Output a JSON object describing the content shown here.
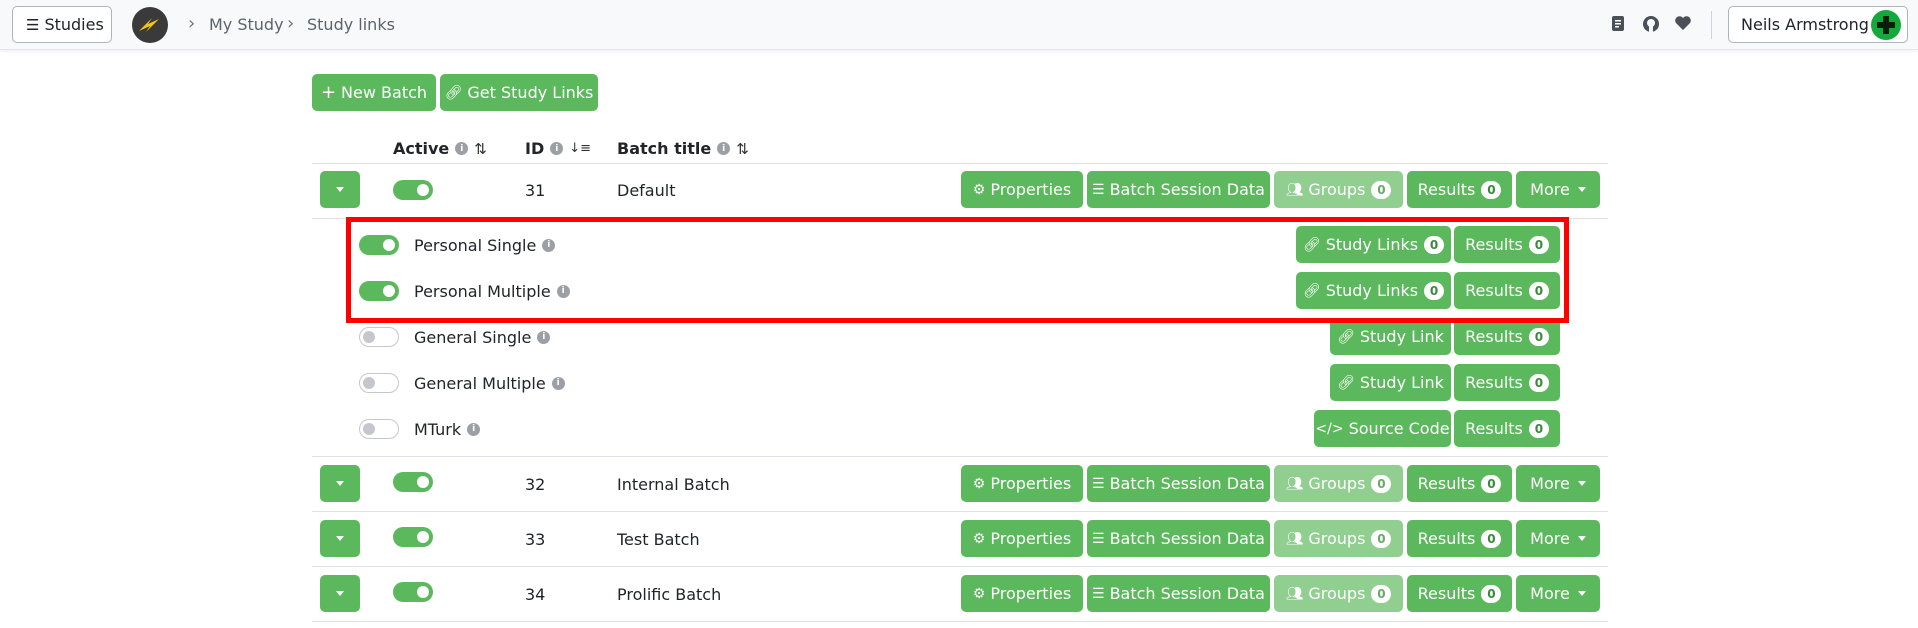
{
  "navbar": {
    "studies_label": "Studies",
    "breadcrumb": [
      "My Study",
      "Study links"
    ],
    "user_name": "Neils Armstrong"
  },
  "toolbar": {
    "new_batch": "New Batch",
    "get_study_links": "Get Study Links"
  },
  "table": {
    "headers": {
      "active": "Active",
      "id": "ID",
      "batch_title": "Batch title"
    },
    "buttons": {
      "properties": "Properties",
      "batch_session_data": "Batch Session Data",
      "groups": "Groups",
      "results": "Results",
      "more": "More"
    },
    "batches": [
      {
        "id": "31",
        "title": "Default",
        "active": true,
        "groups_count": "0",
        "results_count": "0"
      },
      {
        "id": "32",
        "title": "Internal Batch",
        "active": true,
        "groups_count": "0",
        "results_count": "0"
      },
      {
        "id": "33",
        "title": "Test Batch",
        "active": true,
        "groups_count": "0",
        "results_count": "0"
      },
      {
        "id": "34",
        "title": "Prolific Batch",
        "active": true,
        "groups_count": "0",
        "results_count": "0"
      }
    ],
    "worker_types": [
      {
        "name": "Personal Single",
        "active": true,
        "link_label": "Study Links",
        "link_count": "0",
        "results_label": "Results",
        "results_count": "0"
      },
      {
        "name": "Personal Multiple",
        "active": true,
        "link_label": "Study Links",
        "link_count": "0",
        "results_label": "Results",
        "results_count": "0"
      },
      {
        "name": "General Single",
        "active": false,
        "link_label": "Study Link",
        "results_label": "Results",
        "results_count": "0"
      },
      {
        "name": "General Multiple",
        "active": false,
        "link_label": "Study Link",
        "results_label": "Results",
        "results_count": "0"
      },
      {
        "name": "MTurk",
        "active": false,
        "link_label": "Source Code",
        "results_label": "Results",
        "results_count": "0"
      }
    ]
  },
  "colors": {
    "accent": "#5cb85c",
    "accent_disabled": "#91cf91",
    "highlight": "#ff0000"
  }
}
